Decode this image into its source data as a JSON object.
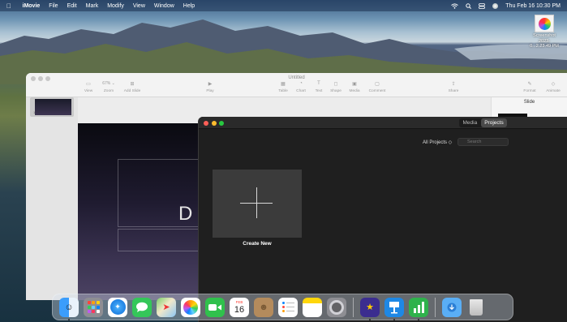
{
  "menubar": {
    "apple_glyph": "",
    "app_name": "iMovie",
    "menus": [
      "File",
      "Edit",
      "Mark",
      "Modify",
      "View",
      "Window",
      "Help"
    ],
    "clock": "Thu Feb 16  10:30 PM",
    "status_icons": [
      "wifi-icon",
      "search-icon",
      "control-center-icon",
      "siri-icon"
    ]
  },
  "desktop": {
    "screenshot_label_line1": "Screenshot",
    "screenshot_label_line2": "2023-0...2.23.49 PM"
  },
  "keynote": {
    "title": "Untitled",
    "toolbar": [
      {
        "label": "View",
        "icon": "sidebar-icon"
      },
      {
        "label": "Zoom",
        "value": "67% ⌄",
        "icon": "zoom-icon"
      },
      {
        "label": "Add Slide",
        "icon": "add-slide-icon"
      },
      {
        "label": "Play",
        "icon": "play-icon"
      },
      {
        "label": "Table",
        "icon": "table-icon"
      },
      {
        "label": "Chart",
        "icon": "chart-icon"
      },
      {
        "label": "Text",
        "icon": "text-icon"
      },
      {
        "label": "Shape",
        "icon": "shape-icon"
      },
      {
        "label": "Media",
        "icon": "media-icon"
      },
      {
        "label": "Comment",
        "icon": "comment-icon"
      },
      {
        "label": "Share",
        "icon": "share-icon"
      },
      {
        "label": "Format",
        "icon": "format-icon"
      },
      {
        "label": "Animate",
        "icon": "animate-icon"
      }
    ],
    "slide_number": "1",
    "slide_text_fragment": "D",
    "inspector_title": "Slide"
  },
  "imovie": {
    "tabs": [
      "Media",
      "Projects"
    ],
    "active_tab": "Projects",
    "filter_label": "All Projects ◇",
    "search_placeholder": "Search",
    "create_new_label": "Create New"
  },
  "dock": {
    "apps": [
      "Finder",
      "Launchpad",
      "Safari",
      "Messages",
      "Maps",
      "Photos",
      "FaceTime",
      "Calendar",
      "Contacts",
      "Reminders",
      "Notes",
      "System Settings",
      "iMovie",
      "Keynote",
      "Numbers",
      "Downloads",
      "Trash"
    ],
    "calendar_month": "FEB",
    "calendar_day": "16"
  },
  "colors": {
    "imovie_close": "#ff5f57",
    "imovie_minimize": "#febc2e",
    "imovie_maximize": "#28c840",
    "imovie_background": "#1f1f1f",
    "keynote_background": "#ececec"
  }
}
